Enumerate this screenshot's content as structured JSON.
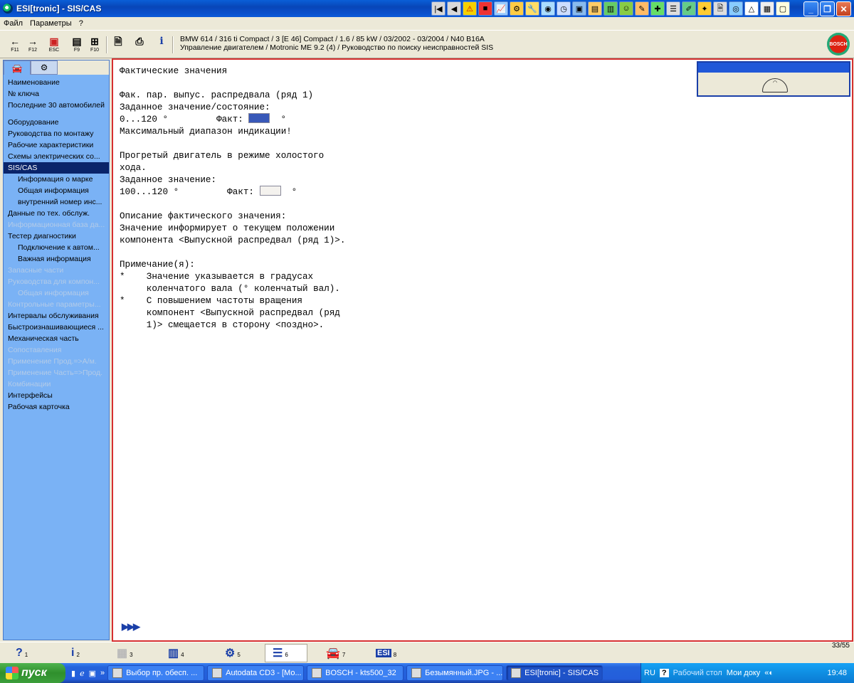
{
  "window": {
    "title": "ESI[tronic] - SIS/CAS"
  },
  "menu": [
    "Файл",
    "Параметры",
    "?"
  ],
  "toolbar": {
    "buttons": [
      {
        "glyph": "←",
        "fkey": "F11"
      },
      {
        "glyph": "→",
        "fkey": "F12"
      },
      {
        "glyph": "▣",
        "fkey": "ESC"
      },
      {
        "glyph": "▤",
        "fkey": "F9"
      },
      {
        "glyph": "⊞",
        "fkey": "F10"
      }
    ],
    "page_glyph": "🗎",
    "print_glyph": "⎙",
    "info_glyph": "i"
  },
  "vehicle": {
    "line1": "BMW 614 / 316 ti Compact / 3 [E 46] Compact / 1.6 / 85 kW / 03/2002 - 03/2004 / N40 B16A",
    "line2": "Управление двигателем / Motronic ME 9.2 (4) / Руководство по поиску неисправностей SIS"
  },
  "bosch_logo": "BOSCH",
  "sidebar": {
    "group1": [
      "Наименование",
      "№ ключа",
      "Последние 30 автомобилей"
    ],
    "group2": [
      {
        "label": "Оборудование",
        "level": 0,
        "state": "normal"
      },
      {
        "label": "Руководства по монтажу",
        "level": 0,
        "state": "normal"
      },
      {
        "label": "Рабочие характеристики",
        "level": 0,
        "state": "normal"
      },
      {
        "label": "Схемы электрических со...",
        "level": 0,
        "state": "normal"
      },
      {
        "label": "SIS/CAS",
        "level": 0,
        "state": "selected"
      },
      {
        "label": "Информация о марке",
        "level": 1,
        "state": "normal"
      },
      {
        "label": "Общая информация",
        "level": 1,
        "state": "normal"
      },
      {
        "label": "внутренний номер инс...",
        "level": 1,
        "state": "normal"
      },
      {
        "label": "Данные по тех. обслуж.",
        "level": 0,
        "state": "normal"
      },
      {
        "label": "Информационная база да...",
        "level": 0,
        "state": "disabled"
      },
      {
        "label": "Тестер диагностики",
        "level": 0,
        "state": "normal"
      },
      {
        "label": "Подключение к автом...",
        "level": 1,
        "state": "normal"
      },
      {
        "label": "Важная информация",
        "level": 1,
        "state": "normal"
      },
      {
        "label": "Запасные части",
        "level": 0,
        "state": "disabled"
      },
      {
        "label": "Руководства для компон...",
        "level": 0,
        "state": "disabled"
      },
      {
        "label": "Общая информация",
        "level": 1,
        "state": "disabled"
      },
      {
        "label": "Контрольные параметры...",
        "level": 0,
        "state": "disabled"
      },
      {
        "label": "Интервалы обслуживания",
        "level": 0,
        "state": "normal"
      },
      {
        "label": "Быстроизнашивающиеся ...",
        "level": 0,
        "state": "normal"
      },
      {
        "label": "Механическая часть",
        "level": 0,
        "state": "normal"
      },
      {
        "label": "Сопоставления",
        "level": 0,
        "state": "disabled"
      },
      {
        "label": "Применение Прод.=>А/м.",
        "level": 0,
        "state": "disabled"
      },
      {
        "label": "Применение Часть=>Прод.",
        "level": 0,
        "state": "disabled"
      },
      {
        "label": "Комбинации",
        "level": 0,
        "state": "disabled"
      },
      {
        "label": "Интерфейсы",
        "level": 0,
        "state": "normal"
      },
      {
        "label": "Рабочая карточка",
        "level": 0,
        "state": "normal"
      }
    ]
  },
  "content": {
    "heading": "Фактические значения",
    "param": "Фак. пар. выпус. распредвала (ряд 1)",
    "setpoint_label": "Заданное значение/состояние:",
    "range1": "0...120 °",
    "fact_label": "Факт:",
    "degree": "°",
    "max_range": "Максимальный диапазон индикации!",
    "warm_engine1": "Прогретый двигатель в режиме холостого",
    "warm_engine2": "хода.",
    "setpoint_label2": "Заданное значение:",
    "range2": "100...120 °",
    "desc_label": "Описание фактического значения:",
    "desc1": "Значение информирует о текущем положении",
    "desc2": "компонента <Выпускной распредвал (ряд 1)>.",
    "note_label": "Примечание(я):",
    "note1a": "Значение указывается в градусах",
    "note1b": "коленчатого вала (° коленчатый вал).",
    "note2a": "С повышением частоты вращения",
    "note2b": "компонент <Выпускной распредвал (ряд",
    "note2c": "1)> смещается в сторону <поздно>.",
    "bullet": "*",
    "next": "▶▶▶"
  },
  "funcbar": [
    {
      "glyph": "?",
      "num": "1",
      "state": "normal"
    },
    {
      "glyph": "i",
      "num": "2",
      "state": "normal"
    },
    {
      "glyph": "▦",
      "num": "3",
      "state": "disabled"
    },
    {
      "glyph": "▥",
      "num": "4",
      "state": "normal"
    },
    {
      "glyph": "⚙",
      "num": "5",
      "state": "normal"
    },
    {
      "glyph": "☰",
      "num": "6",
      "state": "pressed"
    },
    {
      "glyph": "🚘",
      "num": "7",
      "state": "normal"
    },
    {
      "glyph": "ESI",
      "num": "8",
      "state": "normal"
    }
  ],
  "page_counter": "33/55",
  "taskbar": {
    "start": "пуск",
    "tasks": [
      {
        "label": "Выбор пр. обесп. ...",
        "active": false
      },
      {
        "label": "Autodata CD3 - [Мо...",
        "active": false
      },
      {
        "label": "BOSCH - kts500_32",
        "active": false
      },
      {
        "label": "Безымянный.JPG - ...",
        "active": false
      },
      {
        "label": "ESI[tronic] - SIS/CAS",
        "active": true
      }
    ],
    "lang": "RU",
    "desktop": "Рабочий стол",
    "my_docs": "Мои доку",
    "time": "19:48"
  }
}
